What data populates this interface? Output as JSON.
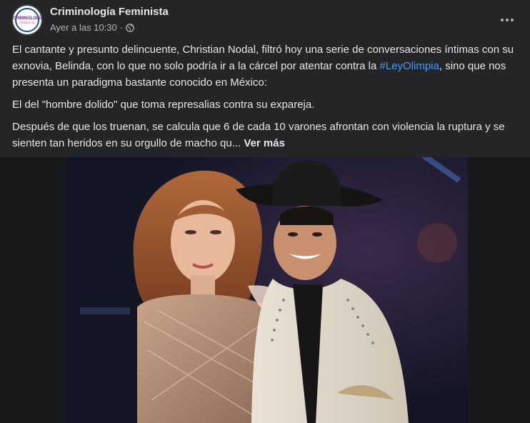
{
  "post": {
    "page_name": "Criminología Feminista",
    "timestamp": "Ayer a las 10:30",
    "separator": "·",
    "avatar": {
      "logo_text": "CRIMINOLOGÍA",
      "logo_sub": "FEMINISTA"
    },
    "paragraphs": {
      "p1_before": "El cantante y presunto delincuente, Christian Nodal, filtró hoy una serie de conversaciones íntimas con su exnovia, Belinda, con lo que no solo podría ir a la cárcel por atentar contra la ",
      "p1_hashtag": "#LeyOlimpia",
      "p1_after": ", sino que nos presenta un paradigma bastante conocido en México:",
      "p2": "El del \"hombre dolido\" que toma represalias contra su expareja.",
      "p3": "Después de que los truenan, se calcula que 6 de cada 10 varones afrontan con violencia la ruptura y se sienten tan heridos en su orgullo de macho qu...",
      "see_more": "Ver más"
    }
  },
  "icons": {
    "privacy": "globe-icon",
    "more": "more-options-icon"
  },
  "colors": {
    "background": "#242526",
    "text_primary": "#e4e6eb",
    "text_secondary": "#b0b3b8",
    "hashtag": "#4599ff"
  }
}
